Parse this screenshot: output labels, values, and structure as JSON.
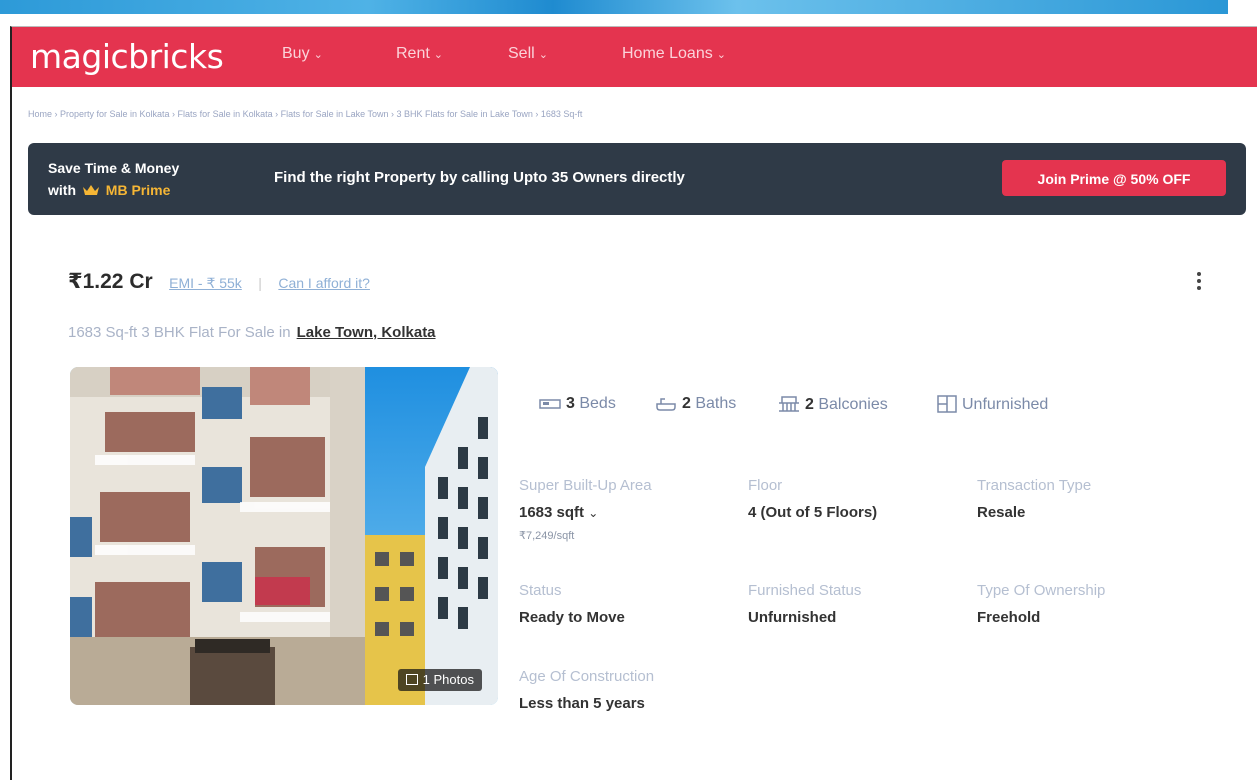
{
  "brand": {
    "name": "magicbricks",
    "color": "#e4344f"
  },
  "nav": {
    "items": [
      {
        "label": "Buy"
      },
      {
        "label": "Rent"
      },
      {
        "label": "Sell"
      },
      {
        "label": "Home Loans"
      }
    ]
  },
  "breadcrumb": "Home › Property for Sale in Kolkata › Flats for Sale in Kolkata › Flats for Sale in Lake Town › 3 BHK Flats for Sale in Lake Town › 1683 Sq-ft",
  "banner": {
    "line1": "Save Time & Money",
    "line2_prefix": "with",
    "prime": "MB Prime",
    "message": "Find the right Property by calling Upto 35 Owners directly",
    "cta": "Join Prime @ 50% OFF"
  },
  "listing": {
    "price": "₹1.22 Cr",
    "emi": "EMI - ₹ 55k",
    "separator": "|",
    "afford": "Can I afford it?",
    "title": "1683 Sq-ft 3 BHK Flat For Sale in",
    "location": "Lake Town, Kolkata",
    "photos_badge": "1 Photos",
    "summary": {
      "beds_num": "3",
      "beds_label": "Beds",
      "baths_num": "2",
      "baths_label": "Baths",
      "balconies_num": "2",
      "balconies_label": "Balconies",
      "furnishing": "Unfurnished"
    },
    "specs": {
      "super_area_label": "Super Built-Up Area",
      "super_area_value": "1683 sqft",
      "price_per_sqft": "₹7,249/sqft",
      "floor_label": "Floor",
      "floor_value": "4 (Out of 5 Floors)",
      "transaction_label": "Transaction Type",
      "transaction_value": "Resale",
      "status_label": "Status",
      "status_value": "Ready to Move",
      "furnished_label": "Furnished Status",
      "furnished_value": "Unfurnished",
      "ownership_label": "Type Of Ownership",
      "ownership_value": "Freehold",
      "age_label": "Age Of Construction",
      "age_value": "Less than 5 years"
    }
  }
}
